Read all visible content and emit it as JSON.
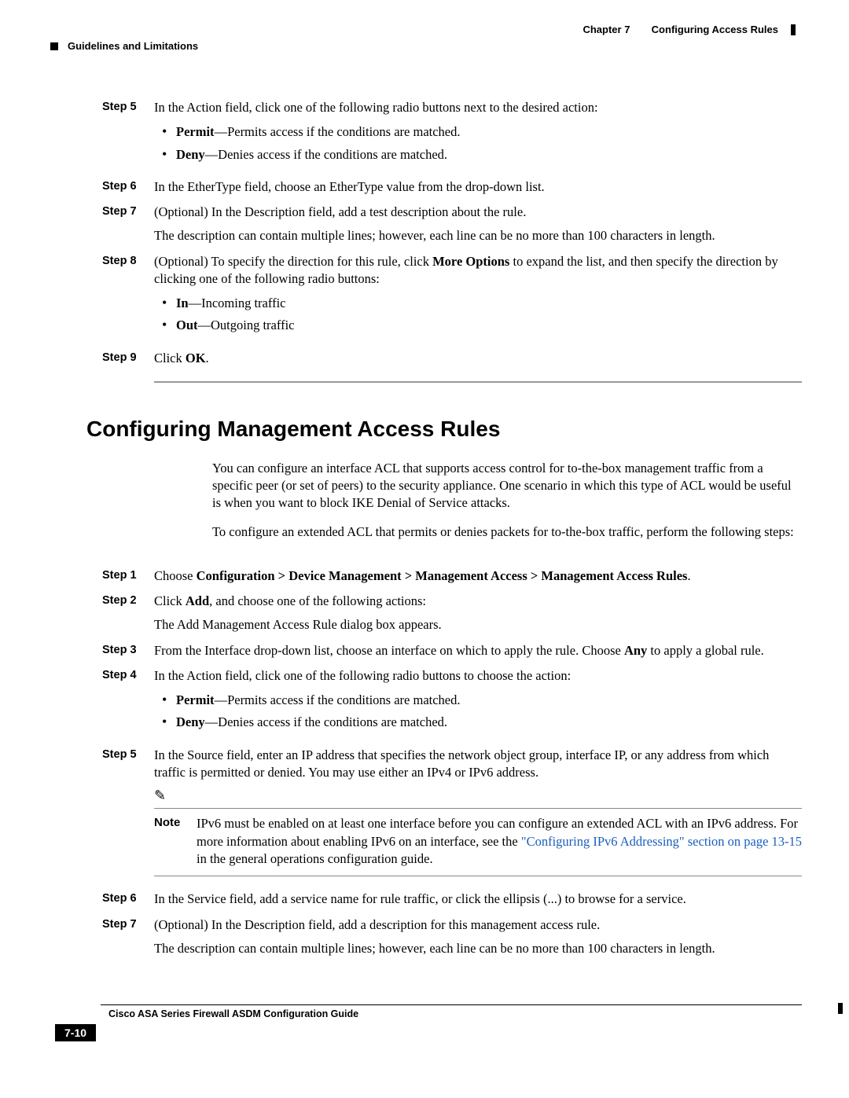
{
  "header": {
    "chapter": "Chapter 7",
    "title": "Configuring Access Rules",
    "section": "Guidelines and Limitations"
  },
  "stepsA": {
    "s5": {
      "label": "Step 5",
      "text": "In the Action field, click one of the following radio buttons next to the desired action:",
      "b1a": "Permit",
      "b1b": "—Permits access if the conditions are matched.",
      "b2a": "Deny",
      "b2b": "—Denies access if the conditions are matched."
    },
    "s6": {
      "label": "Step 6",
      "text": "In the EtherType field, choose an EtherType value from the drop-down list."
    },
    "s7": {
      "label": "Step 7",
      "text": "(Optional) In the Description field, add a test description about the rule.",
      "extra": "The description can contain multiple lines; however, each line can be no more than 100 characters in length."
    },
    "s8": {
      "label": "Step 8",
      "t1": "(Optional) To specify the direction for this rule, click ",
      "t2": "More Options",
      "t3": " to expand the list, and then specify the direction by clicking one of the following radio buttons:",
      "b1a": "In",
      "b1b": "—Incoming traffic",
      "b2a": "Out",
      "b2b": "—Outgoing traffic"
    },
    "s9": {
      "label": "Step 9",
      "t1": "Click ",
      "t2": "OK",
      "t3": "."
    }
  },
  "section2": {
    "heading": "Configuring Management Access Rules",
    "intro1": "You can configure an interface ACL that supports access control for to-the-box management traffic from a specific peer (or set of peers) to the security appliance. One scenario in which this type of ACL would be useful is when you want to block IKE Denial of Service attacks.",
    "intro2": "To configure an extended ACL that permits or denies packets for to-the-box traffic, perform the following steps:"
  },
  "stepsB": {
    "s1": {
      "label": "Step 1",
      "t1": "Choose ",
      "t2": "Configuration > Device Management > Management Access > Management Access Rules",
      "t3": "."
    },
    "s2": {
      "label": "Step 2",
      "t1": "Click ",
      "t2": "Add",
      "t3": ", and choose one of the following actions:",
      "extra": "The Add Management Access Rule dialog box appears."
    },
    "s3": {
      "label": "Step 3",
      "t1": "From the Interface drop-down list, choose an interface on which to apply the rule. Choose ",
      "t2": "Any",
      "t3": " to apply a global rule."
    },
    "s4": {
      "label": "Step 4",
      "text": "In the Action field, click one of the following radio buttons to choose the action:",
      "b1a": "Permit",
      "b1b": "—Permits access if the conditions are matched.",
      "b2a": "Deny",
      "b2b": "—Denies access if the conditions are matched."
    },
    "s5": {
      "label": "Step 5",
      "text": "In the Source field, enter an IP address that specifies the network object group, interface IP, or any address from which traffic is permitted or denied. You may use either an IPv4 or IPv6 address.",
      "noteLabel": "Note",
      "note1": "IPv6 must be enabled on at least one interface before you can configure an extended ACL with an IPv6 address. For more information about enabling IPv6 on an interface, see the ",
      "noteLink": "\"Configuring IPv6 Addressing\" section on page 13-15",
      "note2": " in the general operations configuration guide."
    },
    "s6": {
      "label": "Step 6",
      "text": "In the Service field, add a service name for rule traffic, or click the ellipsis (...) to browse for a service."
    },
    "s7": {
      "label": "Step 7",
      "text": "(Optional) In the Description field, add a description for this management access rule.",
      "extra": "The description can contain multiple lines; however, each line can be no more than 100 characters in length."
    }
  },
  "footer": {
    "guide": "Cisco ASA Series Firewall ASDM Configuration Guide",
    "page": "7-10"
  }
}
